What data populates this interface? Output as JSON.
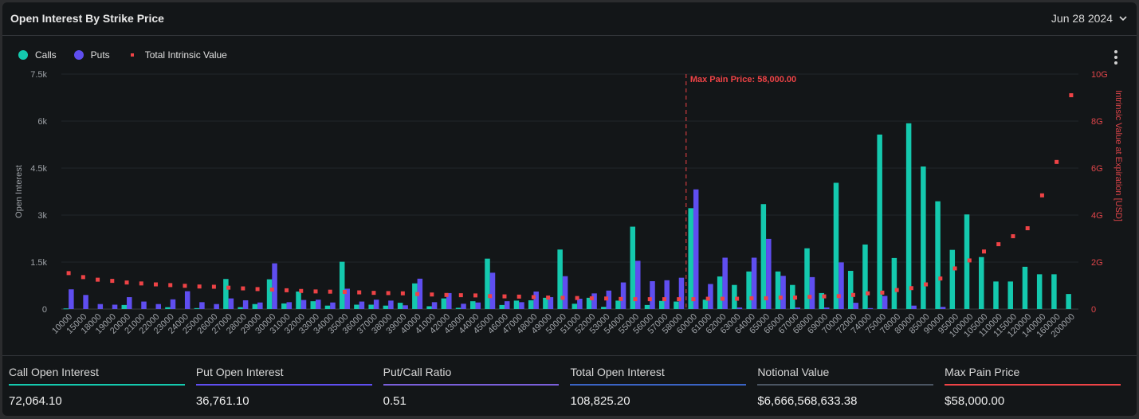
{
  "header": {
    "title": "Open Interest By Strike Price",
    "date": "Jun 28 2024"
  },
  "legend": [
    {
      "label": "Calls",
      "color": "#14c9ae"
    },
    {
      "label": "Puts",
      "color": "#5f4ef0"
    },
    {
      "label": "Total Intrinsic Value",
      "color": "#ee4346"
    }
  ],
  "chart_data": {
    "type": "bar",
    "title": "Open Interest By Strike Price",
    "xlabel": "",
    "ylabel": "Open Interest",
    "y2label": "Intrinsic Value at Expiration [USD]",
    "ylim": [
      0,
      7500
    ],
    "y2lim": [
      0,
      10000000000
    ],
    "yticks": [
      "0",
      "1.5k",
      "3k",
      "4.5k",
      "6k",
      "7.5k"
    ],
    "y2ticks": [
      "0",
      "2G",
      "4G",
      "6G",
      "8G",
      "10G"
    ],
    "grid": true,
    "legend_position": "top-left",
    "annotation": {
      "label": "Max Pain Price: 58,000.00",
      "x": "58000"
    },
    "categories": [
      "10000",
      "15000",
      "18000",
      "19000",
      "20000",
      "21000",
      "22000",
      "23000",
      "24000",
      "25000",
      "26000",
      "27000",
      "28000",
      "29000",
      "30000",
      "31000",
      "32000",
      "33000",
      "34000",
      "35000",
      "36000",
      "37000",
      "38000",
      "39000",
      "40000",
      "41000",
      "42000",
      "43000",
      "44000",
      "45000",
      "46000",
      "47000",
      "48000",
      "49000",
      "50000",
      "51000",
      "52000",
      "53000",
      "54000",
      "55000",
      "56000",
      "57000",
      "58000",
      "60000",
      "61000",
      "62000",
      "63000",
      "64000",
      "65000",
      "66000",
      "67000",
      "68000",
      "69000",
      "70000",
      "72000",
      "74000",
      "75000",
      "78000",
      "80000",
      "85000",
      "90000",
      "95000",
      "100000",
      "105000",
      "110000",
      "115000",
      "120000",
      "140000",
      "160000",
      "200000"
    ],
    "series": [
      {
        "name": "Calls",
        "axis": "left",
        "values": [
          20,
          0,
          0,
          0,
          130,
          0,
          0,
          60,
          0,
          30,
          0,
          960,
          60,
          160,
          950,
          180,
          560,
          250,
          110,
          1510,
          140,
          140,
          110,
          200,
          820,
          90,
          340,
          40,
          250,
          1610,
          130,
          270,
          280,
          360,
          1900,
          170,
          360,
          70,
          270,
          2630,
          130,
          260,
          240,
          3220,
          300,
          1040,
          770,
          1200,
          3350,
          1200,
          770,
          1940,
          510,
          4030,
          1220,
          2060,
          5570,
          1630,
          5930,
          4550,
          3440,
          1890,
          3020,
          1660,
          880,
          880,
          1350,
          1110,
          1110,
          480
        ]
      },
      {
        "name": "Puts",
        "axis": "left",
        "values": [
          630,
          450,
          160,
          140,
          380,
          240,
          160,
          310,
          570,
          220,
          160,
          340,
          280,
          210,
          1460,
          220,
          290,
          300,
          210,
          650,
          240,
          300,
          270,
          120,
          970,
          220,
          510,
          170,
          210,
          1160,
          250,
          220,
          560,
          380,
          1050,
          330,
          500,
          590,
          850,
          1540,
          890,
          920,
          1000,
          3820,
          800,
          1640,
          50,
          1640,
          2240,
          1060,
          50,
          1020,
          50,
          1490,
          200,
          30,
          420,
          0,
          110,
          0,
          70,
          0,
          0,
          0,
          0,
          0,
          0,
          0,
          0,
          0
        ]
      },
      {
        "name": "Total Intrinsic Value",
        "axis": "right",
        "values": [
          1530000000,
          1360000000,
          1250000000,
          1200000000,
          1130000000,
          1090000000,
          1050000000,
          1020000000,
          990000000,
          960000000,
          950000000,
          910000000,
          880000000,
          850000000,
          830000000,
          800000000,
          770000000,
          750000000,
          740000000,
          730000000,
          710000000,
          690000000,
          680000000,
          670000000,
          640000000,
          620000000,
          600000000,
          590000000,
          580000000,
          550000000,
          540000000,
          530000000,
          510000000,
          490000000,
          480000000,
          470000000,
          460000000,
          450000000,
          430000000,
          420000000,
          420000000,
          420000000,
          420000000,
          420000000,
          440000000,
          440000000,
          440000000,
          460000000,
          460000000,
          490000000,
          490000000,
          520000000,
          540000000,
          550000000,
          600000000,
          670000000,
          700000000,
          810000000,
          890000000,
          1050000000,
          1300000000,
          1730000000,
          2070000000,
          2450000000,
          2760000000,
          3100000000,
          3440000000,
          4840000000,
          6260000000,
          9100000000
        ]
      }
    ]
  },
  "footer": [
    {
      "label": "Call Open Interest",
      "value": "72,064.10",
      "color": "#14c9ae"
    },
    {
      "label": "Put Open Interest",
      "value": "36,761.10",
      "color": "#5f4ef0"
    },
    {
      "label": "Put/Call Ratio",
      "value": "0.51",
      "color": "#7a5fd9"
    },
    {
      "label": "Total Open Interest",
      "value": "108,825.20",
      "color": "#3a63c4"
    },
    {
      "label": "Notional Value",
      "value": "$6,666,568,633.38",
      "color": "#4b5562"
    },
    {
      "label": "Max Pain Price",
      "value": "$58,000.00",
      "color": "#ee4346"
    }
  ]
}
